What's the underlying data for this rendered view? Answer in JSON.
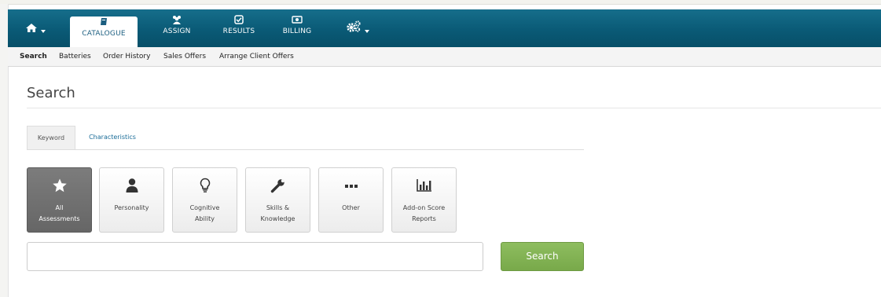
{
  "nav": {
    "items": [
      {
        "label": "CATALOGUE",
        "icon": "book-icon"
      },
      {
        "label": "ASSIGN",
        "icon": "users-icon"
      },
      {
        "label": "RESULTS",
        "icon": "checkbox-icon"
      },
      {
        "label": "BILLING",
        "icon": "money-icon"
      }
    ],
    "home_icon": "home-icon",
    "settings_icon": "gears-icon",
    "bar_color": "#0a5a76",
    "active_text_color": "#1b5e80"
  },
  "subnav": {
    "items": [
      "Search",
      "Batteries",
      "Order History",
      "Sales Offers",
      "Arrange Client Offers"
    ]
  },
  "page": {
    "title": "Search"
  },
  "tabs": {
    "keyword": "Keyword",
    "characteristics": "Characteristics"
  },
  "tiles": [
    {
      "line1": "All",
      "line2": "Assessments",
      "icon": "star-icon"
    },
    {
      "line1": "Personality",
      "line2": "",
      "icon": "person-icon"
    },
    {
      "line1": "Cognitive",
      "line2": "Ability",
      "icon": "lightbulb-icon"
    },
    {
      "line1": "Skills &",
      "line2": "Knowledge",
      "icon": "wrench-icon"
    },
    {
      "line1": "Other",
      "line2": "",
      "icon": "ellipsis-icon"
    },
    {
      "line1": "Add-on Score",
      "line2": "Reports",
      "icon": "bar-chart-icon"
    }
  ],
  "search": {
    "value": "",
    "placeholder": "",
    "button_label": "Search",
    "button_color": "#80b052"
  }
}
